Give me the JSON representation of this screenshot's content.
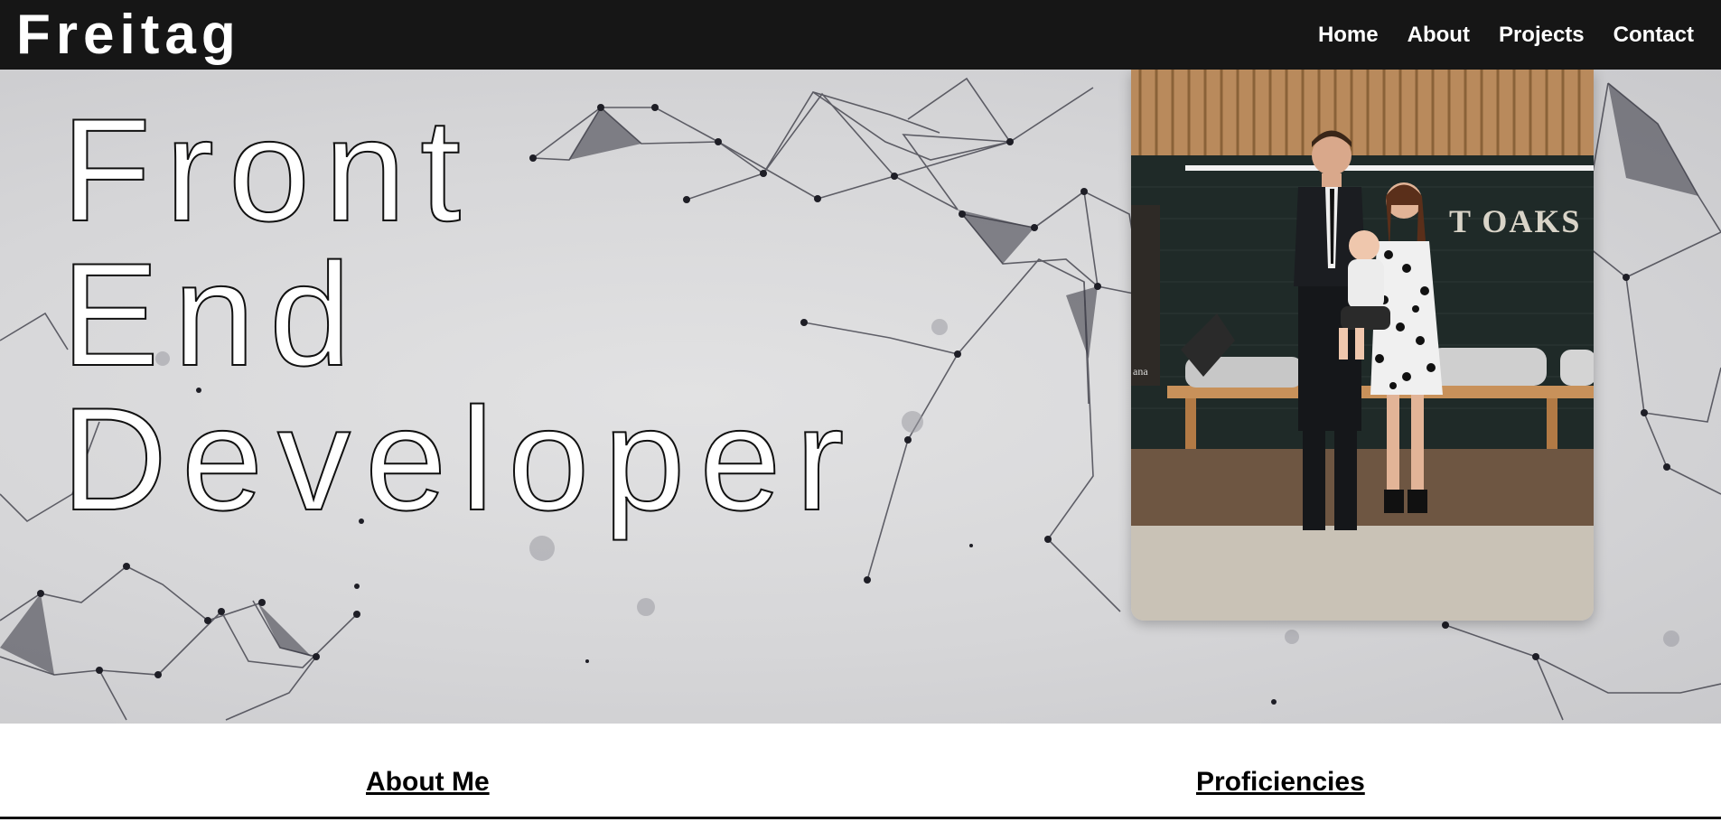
{
  "header": {
    "brand": "Freitag",
    "nav": [
      {
        "label": "Home"
      },
      {
        "label": "About"
      },
      {
        "label": "Projects"
      },
      {
        "label": "Contact"
      }
    ]
  },
  "hero": {
    "headline_lines": [
      "Front",
      "End",
      "Developer"
    ],
    "photo": {
      "wall_sign_text": "T OAKS",
      "left_poster_text": "ana"
    }
  },
  "sections": {
    "about_title": "About Me",
    "proficiencies_title": "Proficiencies"
  },
  "colors": {
    "header_bg": "#161616",
    "hero_bg": "#d6d6d8",
    "text_light": "#ffffff",
    "text_dark": "#000000"
  }
}
